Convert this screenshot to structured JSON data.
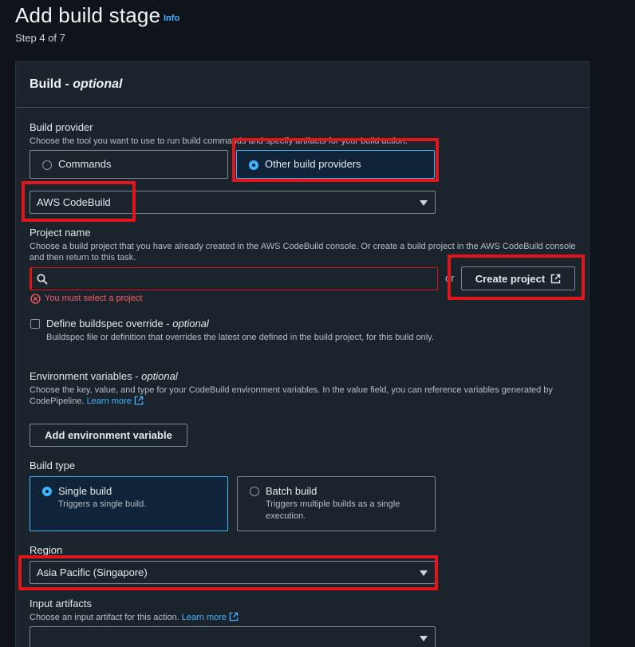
{
  "header": {
    "title": "Add build stage",
    "info": "Info",
    "step": "Step 4 of 7"
  },
  "panel": {
    "title": "Build - ",
    "title_optional": "optional"
  },
  "build_provider": {
    "label": "Build provider",
    "description": "Choose the tool you want to use to run build commands and specify artifacts for your build action.",
    "options": [
      {
        "label": "Commands",
        "selected": false
      },
      {
        "label": "Other build providers",
        "selected": true
      }
    ],
    "provider_select": "AWS CodeBuild"
  },
  "project": {
    "label": "Project name",
    "description": "Choose a build project that you have already created in the AWS CodeBuild console. Or create a build project in the AWS CodeBuild console and then return to this task.",
    "search_value": "",
    "or": "or",
    "create_button": "Create project",
    "error": "You must select a project"
  },
  "buildspec": {
    "label": "Define buildspec override - ",
    "label_optional": "optional",
    "description": "Buildspec file or definition that overrides the latest one defined in the build project, for this build only."
  },
  "env_vars": {
    "label": "Environment variables - ",
    "label_optional": "optional",
    "description": "Choose the key, value, and type for your CodeBuild environment variables. In the value field, you can reference variables generated by CodePipeline.",
    "learn_more": "Learn more",
    "add_button": "Add environment variable"
  },
  "build_type": {
    "label": "Build type",
    "options": [
      {
        "label": "Single build",
        "description": "Triggers a single build.",
        "selected": true
      },
      {
        "label": "Batch build",
        "description": "Triggers multiple builds as a single execution.",
        "selected": false
      }
    ]
  },
  "region": {
    "label": "Region",
    "value": "Asia Pacific (Singapore)"
  },
  "input_artifacts": {
    "label": "Input artifacts",
    "description": "Choose an input artifact for this action.",
    "learn_more": "Learn more",
    "value": ""
  },
  "colors": {
    "accent": "#42b4ff",
    "error": "#d91515",
    "highlight": "#e0161c",
    "panel_bg": "#1b232d",
    "page_bg": "#0f141a"
  }
}
